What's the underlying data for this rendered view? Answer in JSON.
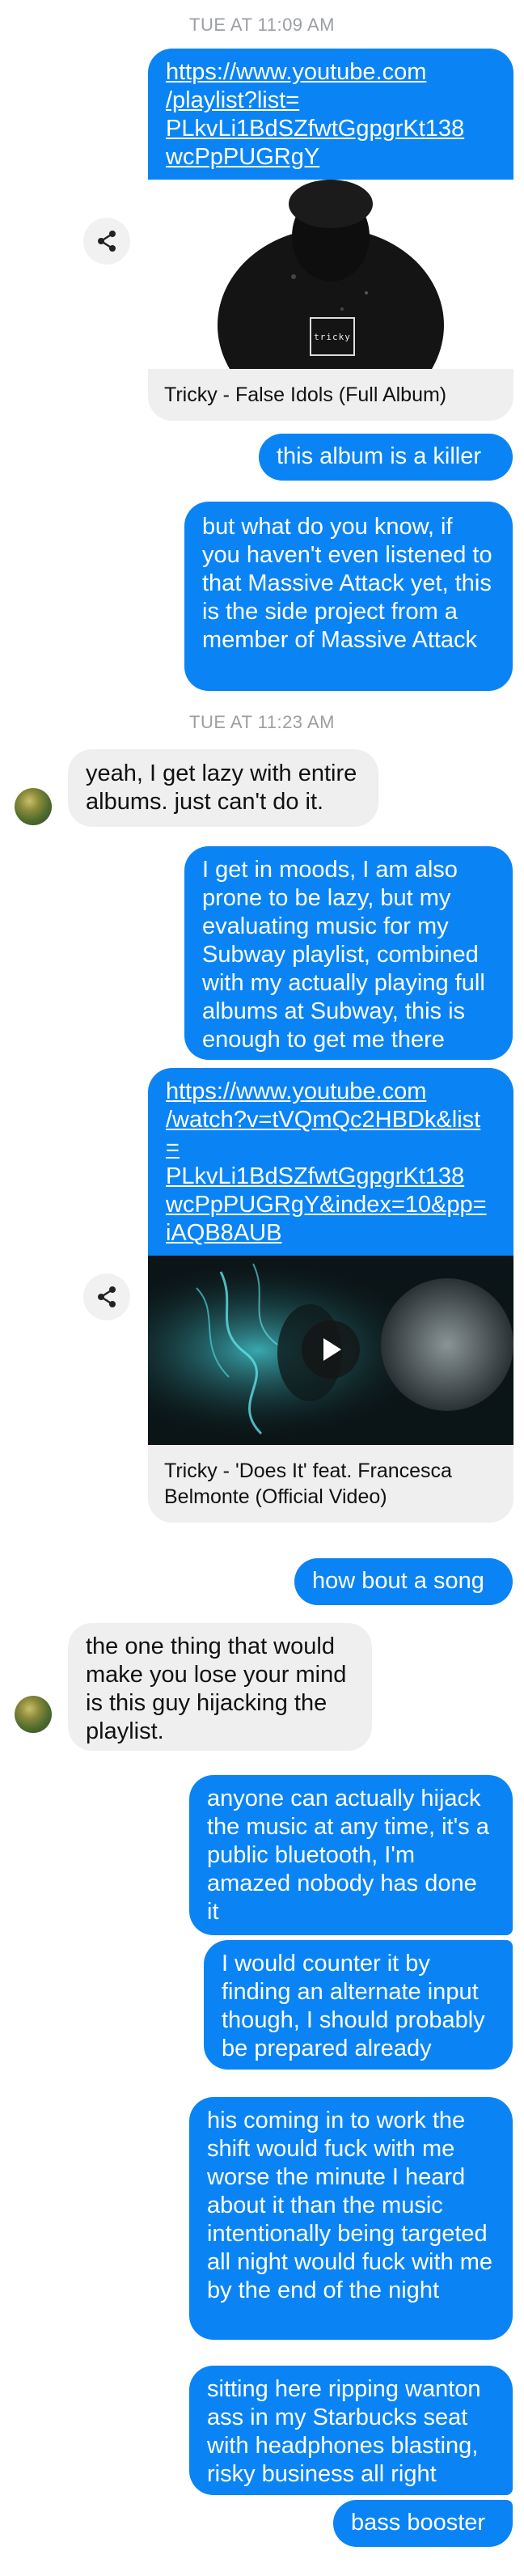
{
  "timestamps": {
    "first": "TUE AT 11:09 AM",
    "second": "TUE AT 11:23 AM"
  },
  "link1": {
    "url": "https://www.youtube.com/playlist?list=PLkvLi1BdSZfwtGgpgrKt138wcPpPUGRgY",
    "url_lines": [
      "https://www.youtube.com",
      "/playlist?list=",
      "PLkvLi1BdSZfwtGgpgrKt138",
      "wcPpPUGRgY"
    ],
    "title": "Tricky - False Idols (Full Album)",
    "logo_text": "tricky"
  },
  "link2": {
    "url_lines": [
      "https://www.youtube.com",
      "/watch?v=tVQmQc2HBDk&list",
      "=",
      "PLkvLi1BdSZfwtGgpgrKt138",
      "wcPpPUGRgY&index=10&pp=",
      "iAQB8AUB"
    ],
    "title_lines": [
      "Tricky - 'Does It' feat. Francesca",
      "Belmonte (Official Video)"
    ]
  },
  "messages": {
    "m1": "this album is a killer",
    "m2": "but what do you know, if you haven't even listened to that Massive Attack yet, this is the side project from a member of Massive Attack",
    "m3": "yeah, I get lazy with entire albums. just can't do it.",
    "m4": "I get in moods, I am also prone to be lazy, but my evaluating music for my Subway playlist, combined with my actually playing full albums at Subway, this is enough to get me there",
    "m5": "how bout a song",
    "m6": "the one thing that would make you lose your mind is this guy hijacking the playlist.",
    "m7": "anyone can actually hijack the music at any time, it's a public bluetooth, I'm amazed nobody has done it",
    "m8": "I would counter it by finding an alternate input though, I should probably be prepared already",
    "m9": "his coming in to work the shift would fuck with me worse the minute I heard about it than the music intentionally being targeted all night would fuck with me by the end of the night",
    "m10": "sitting here ripping wanton ass in my Starbucks seat with headphones blasting, risky business all right",
    "m11": "bass booster"
  },
  "colors": {
    "outgoing_bubble": "#0a84f5",
    "incoming_bubble": "#efefef",
    "timestamp_text": "#9b9ea3"
  },
  "icons": {
    "share": "share-icon",
    "play": "play-icon"
  }
}
